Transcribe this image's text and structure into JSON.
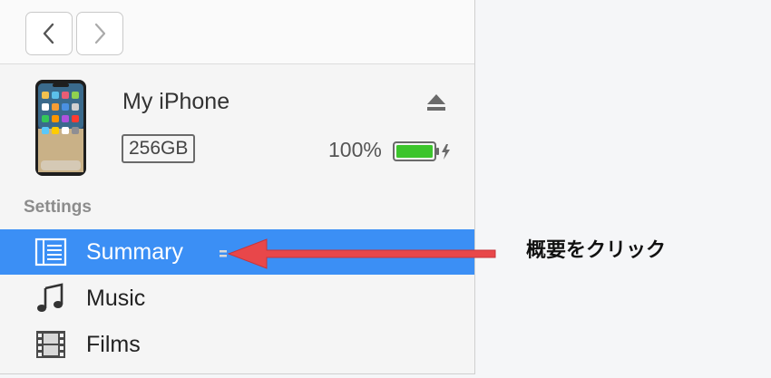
{
  "toolbar": {
    "back_icon": "chevron-left-icon",
    "forward_icon": "chevron-right-icon"
  },
  "device": {
    "name": "My iPhone",
    "capacity": "256GB",
    "battery_percent": "100%",
    "battery_level": 1.0,
    "charging": true,
    "eject_icon": "eject-icon"
  },
  "sidebar": {
    "section_label": "Settings",
    "items": [
      {
        "label": "Summary",
        "icon": "summary-list-icon",
        "selected": true
      },
      {
        "label": "Music",
        "icon": "music-note-icon",
        "selected": false
      },
      {
        "label": "Films",
        "icon": "film-strip-icon",
        "selected": false
      }
    ]
  },
  "annotation": {
    "callout_text": "概要をクリック",
    "arrow_color": "#e8474a"
  },
  "colors": {
    "selection": "#3b8ff5",
    "battery_green": "#3cc52c"
  }
}
